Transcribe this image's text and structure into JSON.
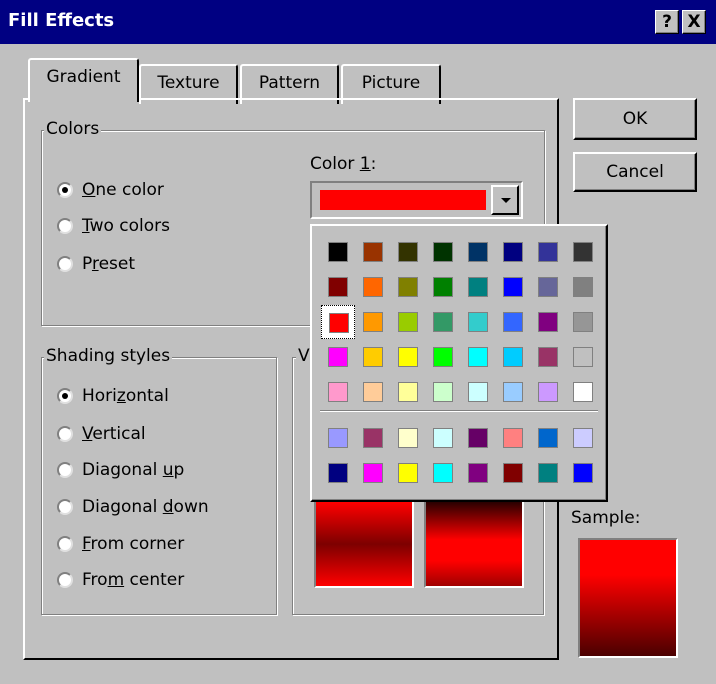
{
  "window": {
    "title": "Fill Effects",
    "help_btn": "?",
    "close_btn": "X"
  },
  "tabs": [
    {
      "label": "Gradient",
      "active": true
    },
    {
      "label": "Texture",
      "active": false
    },
    {
      "label": "Pattern",
      "active": false
    },
    {
      "label": "Picture",
      "active": false
    }
  ],
  "buttons": {
    "ok": "OK",
    "cancel": "Cancel"
  },
  "colors_group": {
    "legend": "Colors",
    "options": [
      {
        "pre": "",
        "key": "O",
        "post": "ne color",
        "selected": true
      },
      {
        "pre": "",
        "key": "T",
        "post": "wo colors",
        "selected": false
      },
      {
        "pre": "P",
        "key": "r",
        "post": "eset",
        "selected": false
      }
    ],
    "color1_label_pre": "Color ",
    "color1_label_key": "1",
    "color1_label_post": ":",
    "color1_value": "#ff0000"
  },
  "shading_group": {
    "legend": "Shading styles",
    "options": [
      {
        "pre": "Hori",
        "key": "z",
        "post": "ontal",
        "selected": true
      },
      {
        "pre": "",
        "key": "V",
        "post": "ertical",
        "selected": false
      },
      {
        "pre": "Diagonal ",
        "key": "u",
        "post": "p",
        "selected": false
      },
      {
        "pre": "Diagonal ",
        "key": "d",
        "post": "own",
        "selected": false
      },
      {
        "pre": "",
        "key": "F",
        "post": "rom corner",
        "selected": false
      },
      {
        "pre": "Fro",
        "key": "m",
        "post": " center",
        "selected": false
      }
    ]
  },
  "variants_legend": "V",
  "sample_label": "Sample:",
  "palette": {
    "rows": [
      [
        "#000000",
        "#993300",
        "#333300",
        "#003300",
        "#003366",
        "#000080",
        "#333399",
        "#333333"
      ],
      [
        "#800000",
        "#ff6600",
        "#808000",
        "#008000",
        "#008080",
        "#0000ff",
        "#666699",
        "#808080"
      ],
      [
        "#ff0000",
        "#ff9900",
        "#99cc00",
        "#339966",
        "#33cccc",
        "#3366ff",
        "#800080",
        "#969696"
      ],
      [
        "#ff00ff",
        "#ffcc00",
        "#ffff00",
        "#00ff00",
        "#00ffff",
        "#00ccff",
        "#993366",
        "#c0c0c0"
      ],
      [
        "#ff99cc",
        "#ffcc99",
        "#ffff99",
        "#ccffcc",
        "#ccffff",
        "#99ccff",
        "#cc99ff",
        "#ffffff"
      ]
    ],
    "chart_rows": [
      [
        "#9999ff",
        "#993366",
        "#ffffcc",
        "#ccffff",
        "#660066",
        "#ff8080",
        "#0066cc",
        "#ccccff"
      ],
      [
        "#000080",
        "#ff00ff",
        "#ffff00",
        "#00ffff",
        "#800080",
        "#800000",
        "#008080",
        "#0000ff"
      ]
    ],
    "selected": {
      "row": 2,
      "col": 0
    }
  }
}
